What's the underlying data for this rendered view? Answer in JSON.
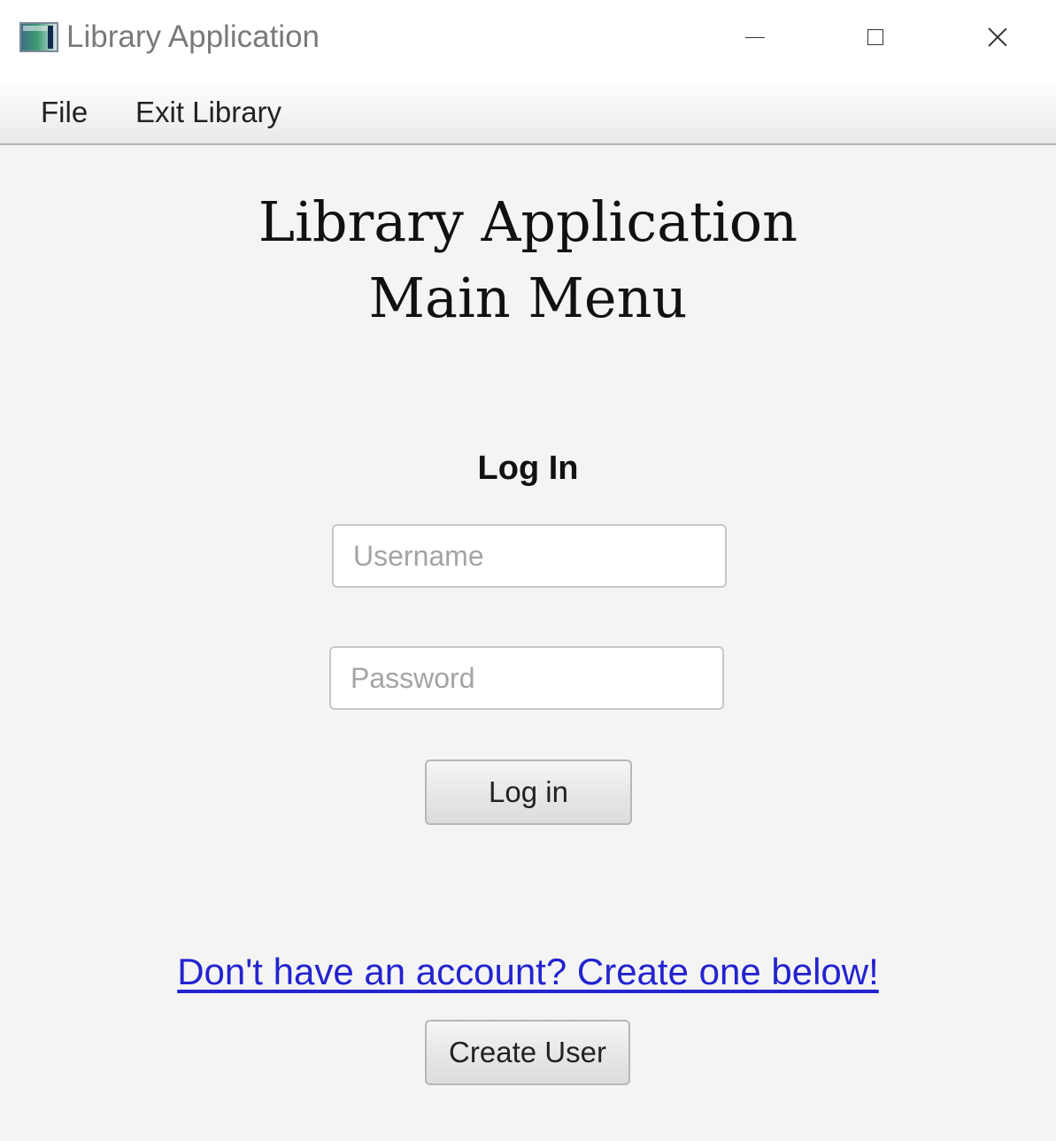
{
  "window": {
    "title": "Library Application"
  },
  "menubar": {
    "items": [
      {
        "label": "File"
      },
      {
        "label": "Exit Library"
      }
    ]
  },
  "heading": {
    "line1": "Library Application",
    "line2": "Main Menu"
  },
  "login": {
    "title": "Log In",
    "username": {
      "value": "",
      "placeholder": "Username"
    },
    "password": {
      "value": "",
      "placeholder": "Password"
    },
    "submit_label": "Log in"
  },
  "signup": {
    "link_text": "Don't have an account? Create one below!",
    "button_label": "Create User"
  },
  "colors": {
    "background": "#f4f4f4",
    "link": "#2323cf",
    "title_text": "#7a7a7a"
  },
  "icons": {
    "app": "app-icon",
    "minimize": "minimize-icon",
    "maximize": "maximize-icon",
    "close": "close-icon"
  }
}
